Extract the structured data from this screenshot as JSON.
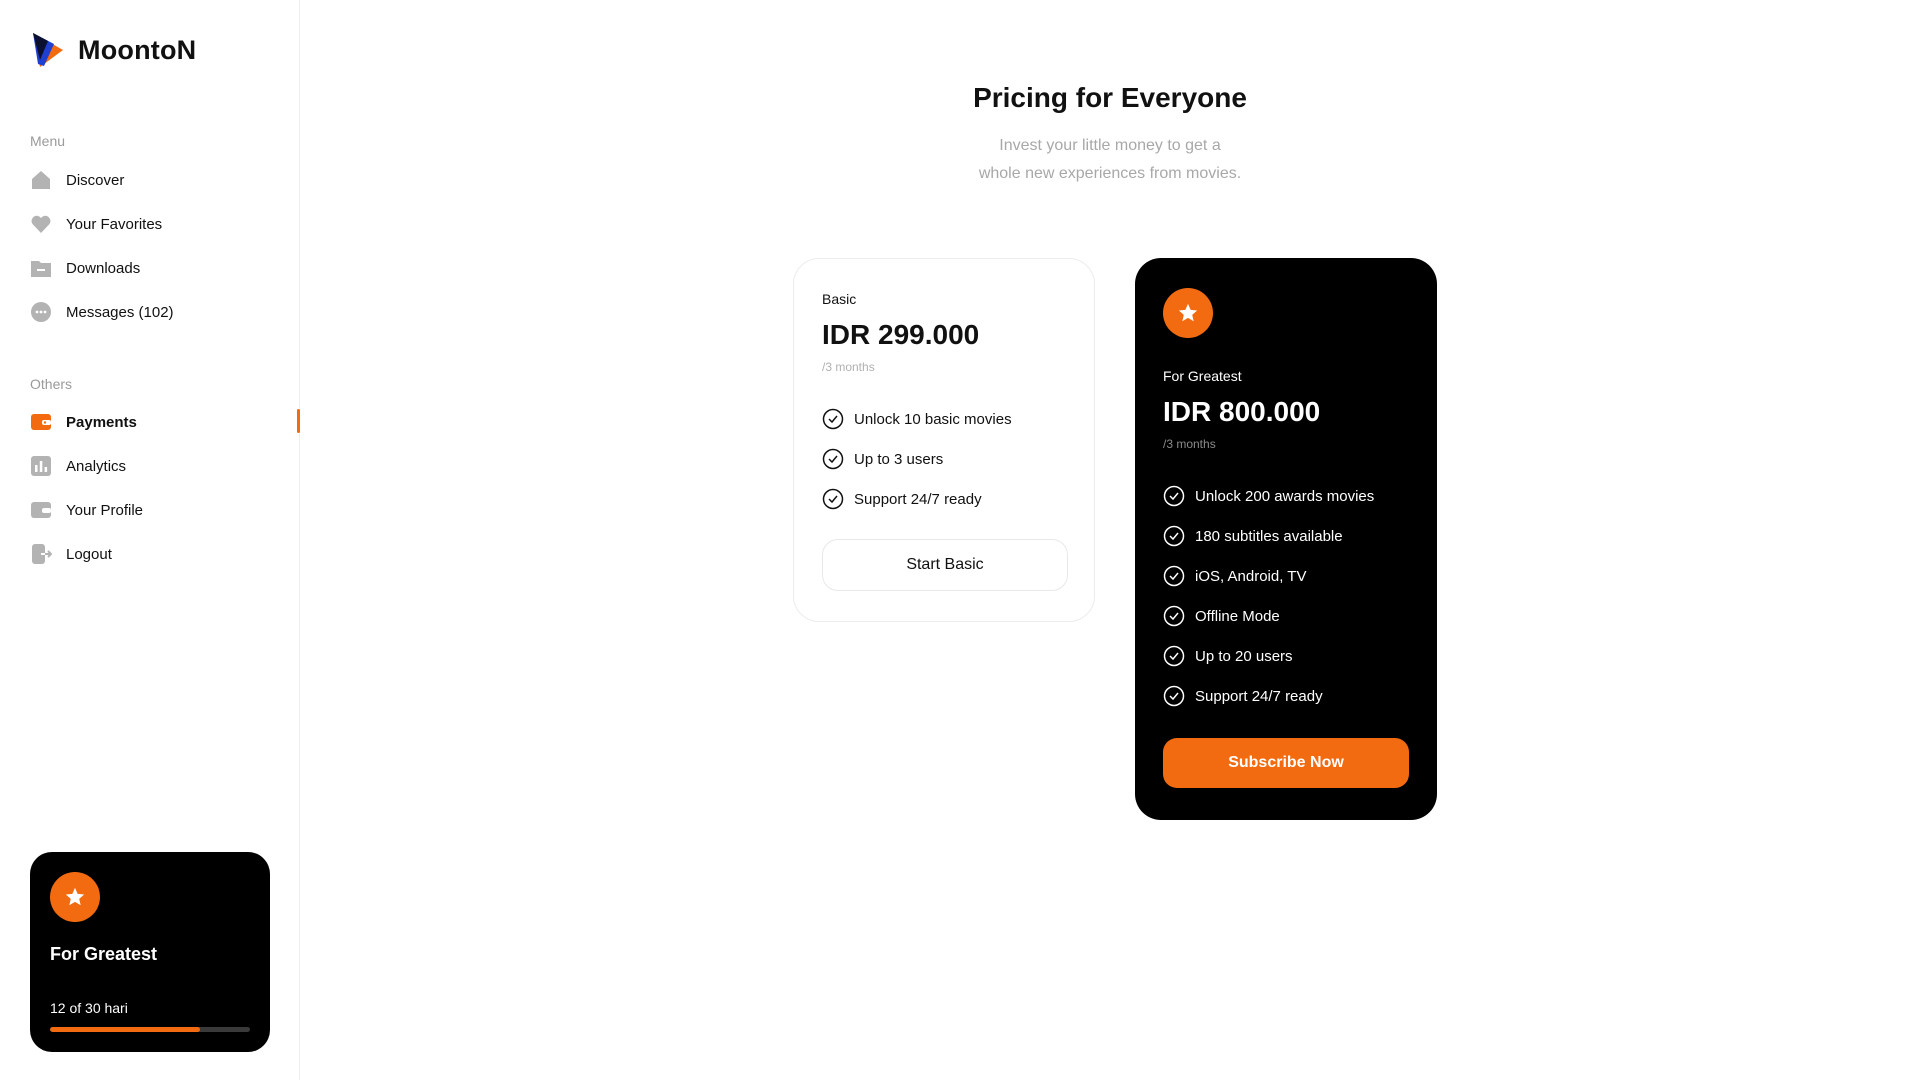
{
  "brand": {
    "name": "MoontoN",
    "accent": "#f26b10"
  },
  "sidebar": {
    "menu_label": "Menu",
    "menu_items": [
      {
        "label": "Discover",
        "icon": "home-icon"
      },
      {
        "label": "Your Favorites",
        "icon": "heart-icon"
      },
      {
        "label": "Downloads",
        "icon": "folder-icon"
      },
      {
        "label": "Messages (102)",
        "icon": "chat-icon"
      }
    ],
    "others_label": "Others",
    "other_items": [
      {
        "label": "Payments",
        "icon": "wallet-icon",
        "active": true
      },
      {
        "label": "Analytics",
        "icon": "chart-icon"
      },
      {
        "label": "Your Profile",
        "icon": "profile-card-icon"
      },
      {
        "label": "Logout",
        "icon": "logout-icon"
      }
    ],
    "promo": {
      "title": "For Greatest",
      "progress_text": "12 of 30 hari",
      "progress_fraction": 0.75
    }
  },
  "main": {
    "title": "Pricing for Everyone",
    "subtitle_line1": "Invest your little money to get a",
    "subtitle_line2": "whole new experiences from movies.",
    "plans": {
      "basic": {
        "name": "Basic",
        "price": "IDR 299.000",
        "period": "/3 months",
        "features": [
          "Unlock 10 basic movies",
          "Up to 3 users",
          "Support 24/7 ready"
        ],
        "button": "Start Basic"
      },
      "premium": {
        "name": "For Greatest",
        "price": "IDR 800.000",
        "period": "/3 months",
        "features": [
          "Unlock 200 awards movies",
          "180 subtitles available",
          "iOS, Android, TV",
          "Offline Mode",
          "Up to 20 users",
          "Support 24/7 ready"
        ],
        "button": "Subscribe Now"
      }
    }
  }
}
